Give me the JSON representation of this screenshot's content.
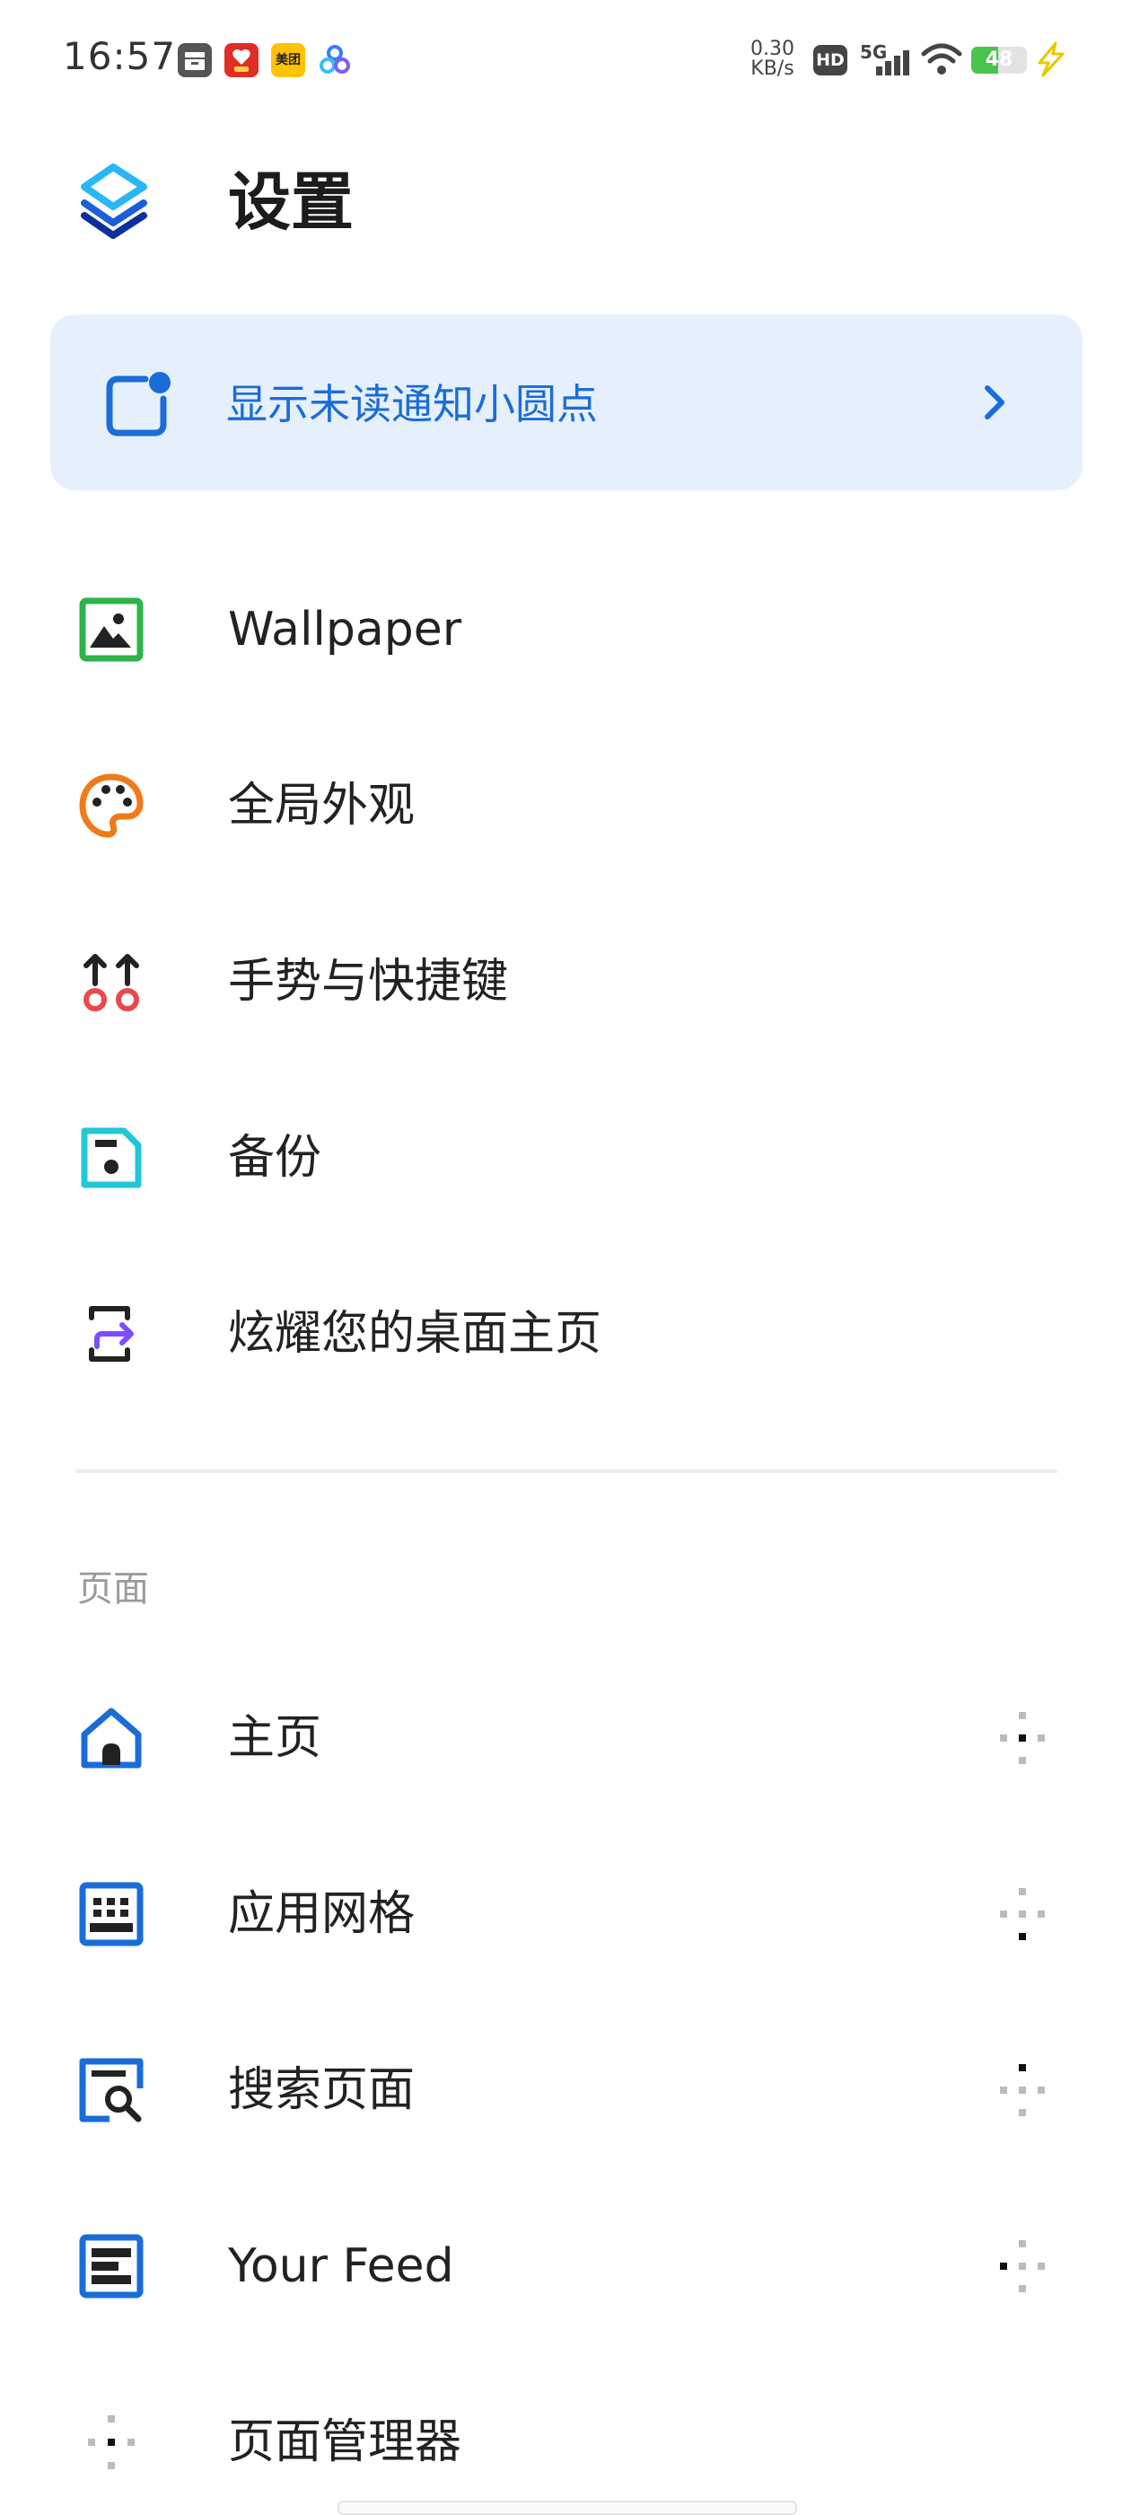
{
  "status_bar": {
    "time": "16:57",
    "net_speed_value": "0.30",
    "net_speed_unit": "KB/s",
    "hd_label": "HD",
    "network_label": "5G",
    "battery": "48",
    "battery_level": 0.48,
    "notification_icons": [
      "storage-icon",
      "pinduoduo-app-icon",
      "meituan-app-icon",
      "cloud-app-icon"
    ],
    "meituan_label": "美团"
  },
  "header": {
    "title": "设置",
    "logo_icon": "layers-logo-icon"
  },
  "banner": {
    "label": "显示未读通知小圆点",
    "icon": "notification-dot-icon",
    "accent": "#1a6cd9",
    "background": "#e6f0fd"
  },
  "general_items": [
    {
      "label": "Wallpaper",
      "icon": "wallpaper-icon",
      "color": "#2db34a"
    },
    {
      "label": "全局外观",
      "icon": "palette-icon",
      "color": "#f07a1a"
    },
    {
      "label": "手势与快捷键",
      "icon": "gesture-icon",
      "color": "#e84a4a"
    },
    {
      "label": "备份",
      "icon": "backup-icon",
      "color": "#22c7d6"
    },
    {
      "label": "炫耀您的桌面主页",
      "icon": "share-screen-icon",
      "color": "#7c4dff"
    }
  ],
  "pages_section": {
    "title": "页面",
    "items": [
      {
        "label": "主页",
        "icon": "home-icon"
      },
      {
        "label": "应用网格",
        "icon": "app-grid-icon"
      },
      {
        "label": "搜索页面",
        "icon": "search-page-icon"
      },
      {
        "label": "Your Feed",
        "icon": "feed-icon"
      },
      {
        "label": "页面管理器",
        "icon": "page-manager-icon"
      }
    ],
    "icon_color": "#1a6cd9"
  }
}
